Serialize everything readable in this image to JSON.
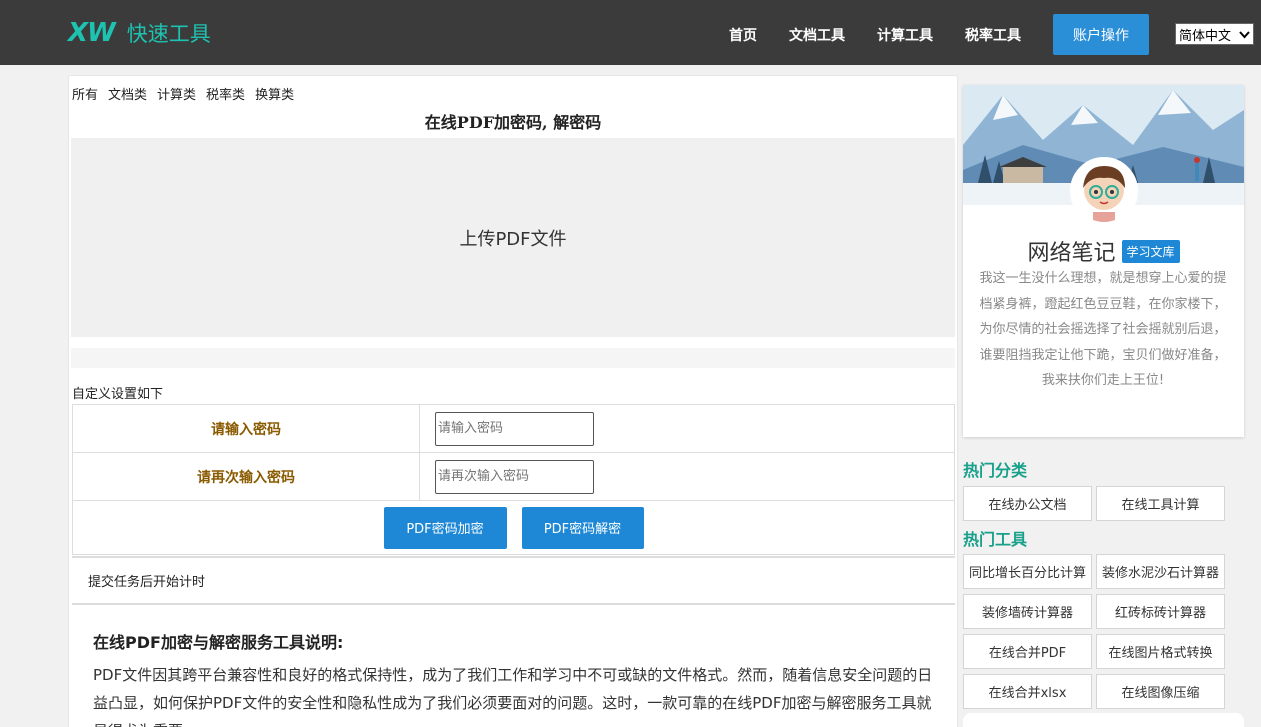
{
  "header": {
    "logo_mark": "XW",
    "logo_text": "快速工具",
    "nav": [
      "首页",
      "文档工具",
      "计算工具",
      "税率工具"
    ],
    "account_button": "账户操作",
    "language": "简体中文"
  },
  "main": {
    "categories": [
      "所有",
      "文档类",
      "计算类",
      "税率类",
      "换算类"
    ],
    "title": "在线PDF加密码, 解密码",
    "upload_label": "上传PDF文件",
    "settings_label": "自定义设置如下",
    "form": {
      "password_label": "请输入密码",
      "password_placeholder": "请输入密码",
      "confirm_label": "请再次输入密码",
      "confirm_placeholder": "请再次输入密码"
    },
    "encrypt_button": "PDF密码加密",
    "decrypt_button": "PDF密码解密",
    "timer_text": "提交任务后开始计时",
    "description": {
      "heading": "在线PDF加密与解密服务工具说明:",
      "body": "PDF文件因其跨平台兼容性和良好的格式保持性，成为了我们工作和学习中不可或缺的文件格式。然而，随着信息安全问题的日益凸显，如何保护PDF文件的安全性和隐私性成为了我们必须要面对的问题。这时，一款可靠的在线PDF加密与解密服务工具就显得尤为重要。"
    }
  },
  "sidebar": {
    "profile_name": "网络笔记",
    "profile_badge": "学习文库",
    "bio": "我这一生没什么理想，就是想穿上心爱的提档紧身裤，蹬起红色豆豆鞋，在你家楼下，为你尽情的社会摇选择了社会摇就别后退，谁要阻挡我定让他下跪，宝贝们做好准备，我来扶你们走上王位!",
    "hot_categories_title": "热门分类",
    "hot_categories": [
      "在线办公文档",
      "在线工具计算"
    ],
    "hot_tools_title": "热门工具",
    "hot_tools": [
      "同比增长百分比计算",
      "装修水泥沙石计算器",
      "装修墙砖计算器",
      "红砖标砖计算器",
      "在线合并PDF",
      "在线图片格式转换",
      "在线合并xlsx",
      "在线图像压缩"
    ]
  },
  "colors": {
    "header_bg": "#3b3b3b",
    "logo": "#1ec2b0",
    "primary_button": "#1e88d6",
    "form_label": "#8a5a00",
    "section_title": "#18a08b"
  }
}
